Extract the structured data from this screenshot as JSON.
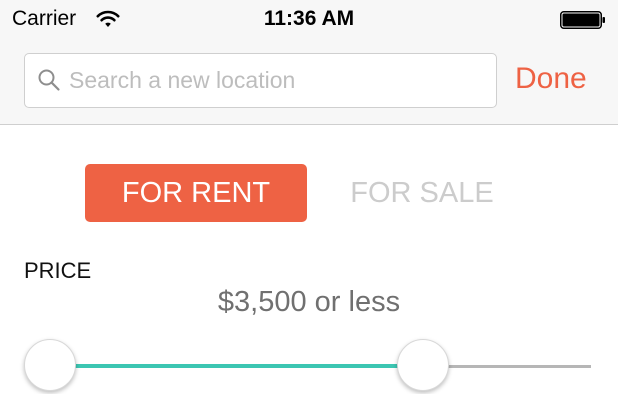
{
  "status_bar": {
    "carrier": "Carrier",
    "time": "11:36 AM",
    "wifi_icon": "wifi-icon",
    "battery_icon": "battery-icon"
  },
  "search": {
    "placeholder": "Search a new location",
    "value": "",
    "icon": "search-icon",
    "done_label": "Done"
  },
  "listing_type": {
    "options": [
      "FOR RENT",
      "FOR SALE"
    ],
    "selected": "FOR RENT"
  },
  "price": {
    "label": "PRICE",
    "value_text": "$3,500 or less",
    "slider_fill_fraction": 0.69
  },
  "colors": {
    "accent": "#ee6244",
    "slider_active": "#3cc6b2",
    "slider_inactive": "#b6b6b6",
    "unselected_text": "#cccccc"
  }
}
